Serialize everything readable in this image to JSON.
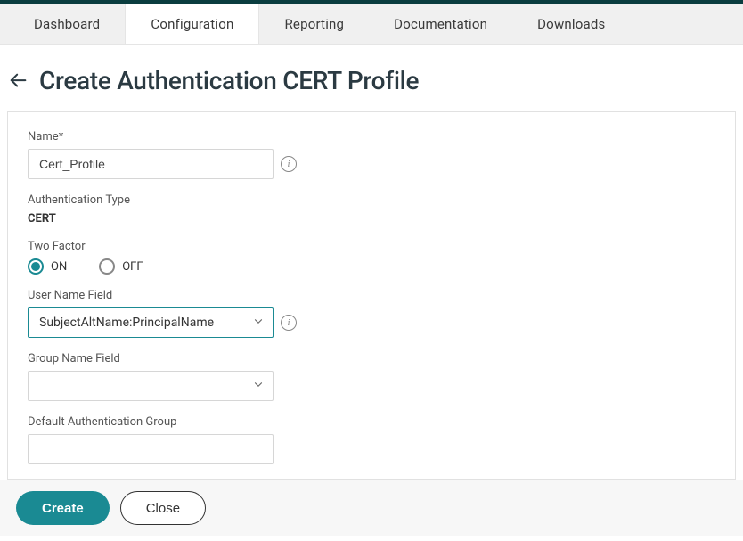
{
  "tabs": {
    "dashboard": "Dashboard",
    "configuration": "Configuration",
    "reporting": "Reporting",
    "documentation": "Documentation",
    "downloads": "Downloads",
    "active": "configuration"
  },
  "page": {
    "title": "Create Authentication CERT Profile"
  },
  "form": {
    "name": {
      "label": "Name*",
      "value": "Cert_Profile"
    },
    "auth_type": {
      "label": "Authentication Type",
      "value": "CERT"
    },
    "two_factor": {
      "label": "Two Factor",
      "options": {
        "on": "ON",
        "off": "OFF"
      },
      "selected": "on"
    },
    "username_field": {
      "label": "User Name Field",
      "value": "SubjectAltName:PrincipalName"
    },
    "group_name_field": {
      "label": "Group Name Field",
      "value": ""
    },
    "default_auth_group": {
      "label": "Default Authentication Group",
      "value": ""
    }
  },
  "footer": {
    "create": "Create",
    "close": "Close"
  }
}
